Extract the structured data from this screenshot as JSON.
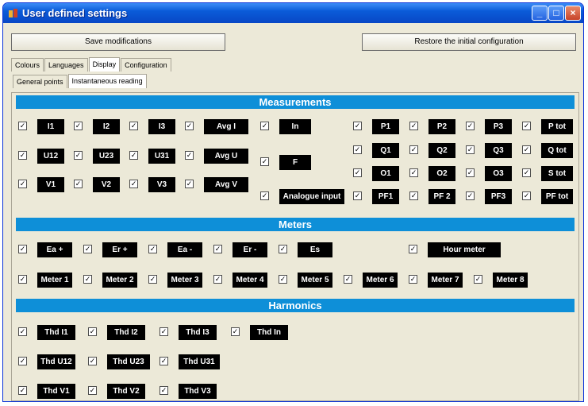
{
  "window": {
    "title": "User defined settings"
  },
  "toolbar": {
    "save_label": "Save modifications",
    "restore_label": "Restore the initial configuration"
  },
  "tabs": [
    "Colours",
    "Languages",
    "Display",
    "Configuration"
  ],
  "subtabs": [
    "General points",
    "Instantaneous reading"
  ],
  "sections": {
    "measurements": "Measurements",
    "meters": "Meters",
    "harmonics": "Harmonics"
  },
  "check_mark": "✓",
  "measurements": {
    "I1": "I1",
    "I2": "I2",
    "I3": "I3",
    "AvgI": "Avg I",
    "In": "In",
    "U12": "U12",
    "U23": "U23",
    "U31": "U31",
    "AvgU": "Avg U",
    "F": "F",
    "V1": "V1",
    "V2": "V2",
    "V3": "V3",
    "AvgV": "Avg V",
    "Analogue": "Analogue input",
    "P1": "P1",
    "P2": "P2",
    "P3": "P3",
    "Ptot": "P tot",
    "Q1": "Q1",
    "Q2": "Q2",
    "Q3": "Q3",
    "Qtot": "Q tot",
    "O1": "O1",
    "O2": "O2",
    "O3": "O3",
    "Stot": "S tot",
    "PF1": "PF1",
    "PF2": "PF 2",
    "PF3": "PF3",
    "PFtot": "PF tot"
  },
  "meters": {
    "Eap": "Ea +",
    "Erp": "Er +",
    "Eam": "Ea -",
    "Erm": "Er -",
    "Es": "Es",
    "Hour": "Hour meter",
    "M1": "Meter 1",
    "M2": "Meter 2",
    "M3": "Meter 3",
    "M4": "Meter 4",
    "M5": "Meter 5",
    "M6": "Meter 6",
    "M7": "Meter 7",
    "M8": "Meter 8"
  },
  "harmonics": {
    "I1": "Thd I1",
    "I2": "Thd I2",
    "I3": "Thd I3",
    "In": "Thd In",
    "U12": "Thd U12",
    "U23": "Thd U23",
    "U31": "Thd U31",
    "V1": "Thd V1",
    "V2": "Thd V2",
    "V3": "Thd V3"
  }
}
